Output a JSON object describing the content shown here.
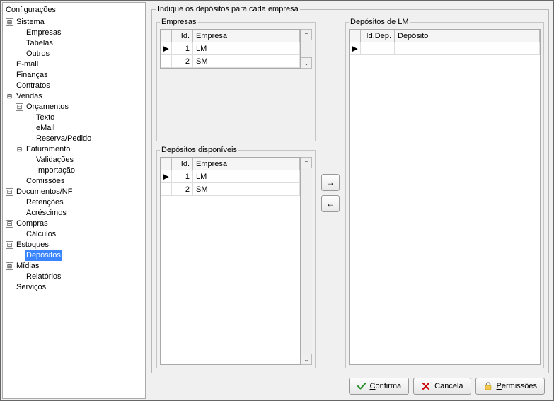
{
  "window": {
    "title": "Configurações"
  },
  "tree": {
    "toggle_minus": "⊟",
    "nodes": {
      "sistema": "Sistema",
      "empresas": "Empresas",
      "tabelas": "Tabelas",
      "outros": "Outros",
      "email": "E-mail",
      "financas": "Finanças",
      "contratos": "Contratos",
      "vendas": "Vendas",
      "orcamentos": "Orçamentos",
      "texto": "Texto",
      "emailv": "eMail",
      "reserva": "Reserva/Pedido",
      "faturamento": "Faturamento",
      "validacoes": "Validações",
      "importacao": "Importação",
      "comissoes": "Comissões",
      "documentos": "Documentos/NF",
      "retencoes": "Retenções",
      "acrescimos": "Acréscimos",
      "compras": "Compras",
      "calculos": "Cálculos",
      "estoques": "Estoques",
      "depositos": "Depósitos",
      "midias": "Mídias",
      "relatorios": "Relatórios",
      "servicos": "Serviços"
    }
  },
  "main": {
    "title": "Indique os depósitos para cada empresa",
    "groups": {
      "empresas": "Empresas",
      "disponiveis": "Depósitos disponíveis",
      "de_empresa": "Depósitos de LM"
    },
    "headers": {
      "id": "Id.",
      "empresa": "Empresa",
      "iddep": "Id.Dep.",
      "deposito": "Depósito"
    },
    "scroll": {
      "up": "⌃",
      "down": "⌄"
    },
    "move": {
      "right": "→",
      "left": "←"
    },
    "rows_empresas": [
      {
        "id": "1",
        "empresa": "LM",
        "current": true
      },
      {
        "id": "2",
        "empresa": "SM",
        "current": false
      }
    ],
    "rows_disponiveis": [
      {
        "id": "1",
        "empresa": "LM",
        "current": true
      },
      {
        "id": "2",
        "empresa": "SM",
        "current": false
      }
    ],
    "rows_destino": []
  },
  "buttons": {
    "confirma": "Confirma",
    "cancela": "Cancela",
    "permissoes": "Permissões"
  }
}
